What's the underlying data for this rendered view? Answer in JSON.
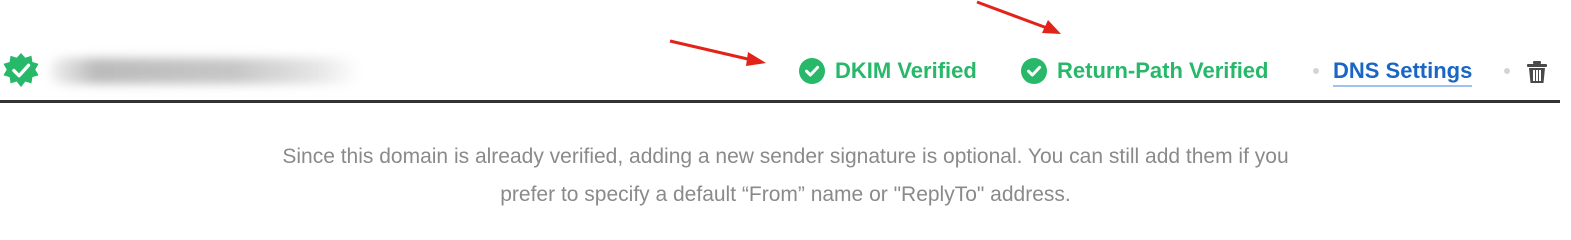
{
  "domain_row": {
    "domain_name": "",
    "badge_icon": "verified-badge-icon",
    "statuses": [
      {
        "label": "DKIM Verified",
        "icon": "check-circle-icon"
      },
      {
        "label": "Return-Path Verified",
        "icon": "check-circle-icon"
      }
    ],
    "dns_settings_label": "DNS Settings",
    "delete_icon": "trash-icon"
  },
  "info": {
    "line1": "Since this domain is already verified, adding a new sender signature is optional. You can still add them if you",
    "line2": "prefer to specify a default “From” name or \"ReplyTo\" address."
  },
  "colors": {
    "verified_green": "#27b86a",
    "link_blue": "#1a66c5",
    "annotation_red": "#e2231a",
    "divider": "#333333",
    "muted_text": "#8a8a8a"
  }
}
